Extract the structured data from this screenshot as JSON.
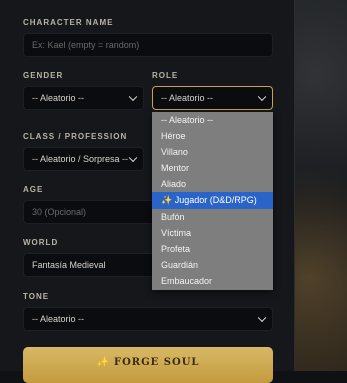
{
  "form": {
    "top_fragment": "",
    "character_name": {
      "label": "CHARACTER NAME",
      "placeholder": "Ex: Kael (empty = random)"
    },
    "gender": {
      "label": "GENDER",
      "value": "-- Aleatorio --"
    },
    "role": {
      "label": "ROLE",
      "value": "-- Aleatorio --"
    },
    "class": {
      "label": "CLASS / PROFESSION",
      "value": "-- Aleatorio / Sorpresa --"
    },
    "age": {
      "label": "AGE",
      "placeholder": "30 (Opcional)"
    },
    "world": {
      "label": "WORLD",
      "value": "Fantasía Medieval"
    },
    "tone": {
      "label": "TONE",
      "value": "-- Aleatorio --"
    },
    "forge_button": {
      "icon": "sparkle-icon",
      "label": "FORGE SOUL"
    }
  },
  "role_dropdown": {
    "items": [
      "-- Aleatorio --",
      "Héroe",
      "Villano",
      "Mentor",
      "Aliado",
      "✨ Jugador (D&D/RPG)",
      "Bufón",
      "Víctima",
      "Profeta",
      "Guardián",
      "Embaucador"
    ],
    "selected_index": 5
  },
  "colors": {
    "accent_gold": "#c9a24a",
    "selection_blue": "#2a64c8",
    "panel_bg": "#15171b"
  }
}
